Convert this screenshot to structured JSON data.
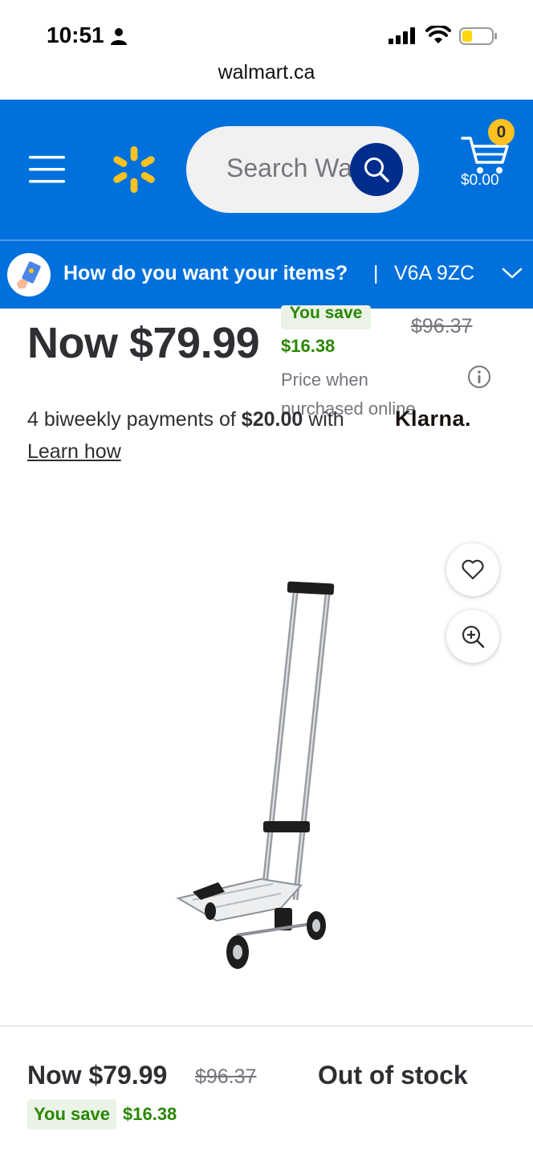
{
  "status_bar": {
    "time": "10:51"
  },
  "browser": {
    "url": "walmart.ca"
  },
  "header": {
    "search_placeholder": "Search Wal",
    "cart_count": "0",
    "cart_total": "$0.00",
    "brand_color": "#0071dc",
    "spark_color": "#ffc220"
  },
  "delivery": {
    "question": "How do you want your items?",
    "separator": "|",
    "postal": "V6A 9ZC"
  },
  "price": {
    "now": "Now $79.99",
    "you_save_label": "You save",
    "save_amount": "$16.38",
    "was": "$96.37",
    "price_when": "Price when purchased online",
    "klarna_prefix": "4 biweekly payments of ",
    "klarna_amount": "$20.00",
    "klarna_suffix": " with",
    "klarna_brand": "Klarna.",
    "learn_how": "Learn how"
  },
  "bottom_bar": {
    "now": "Now $79.99",
    "was": "$96.37",
    "stock": "Out of stock",
    "you_save_label": "You save",
    "save_amount": "$16.38"
  }
}
